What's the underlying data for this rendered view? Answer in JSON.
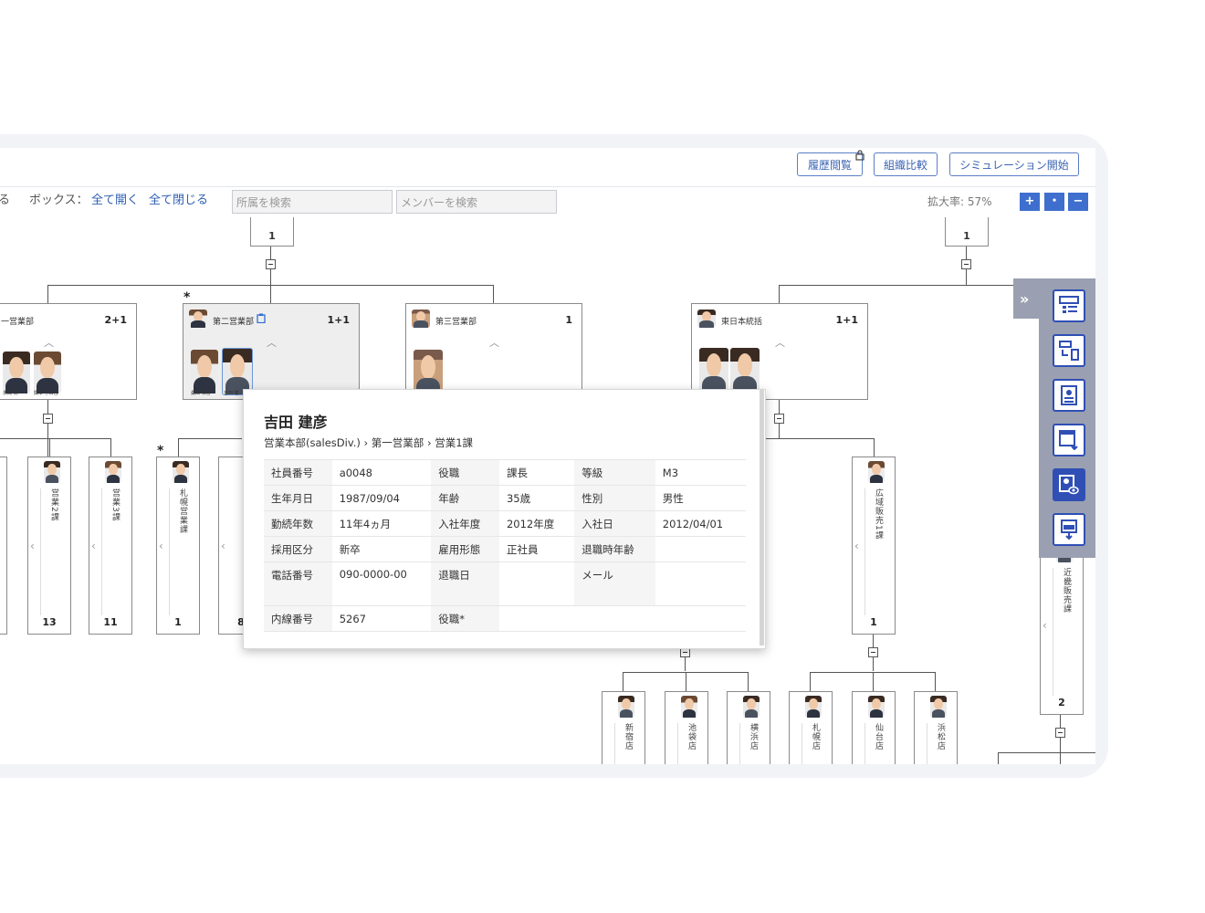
{
  "toolbar": {
    "history_button": "履歴閲覧",
    "compare_button": "組織比較",
    "simulation_button": "シミュレーション開始",
    "partial_left": "る",
    "box_label": "ボックス：",
    "open_all": "全て開く",
    "close_all": "全て閉じる",
    "dept_search_placeholder": "所属を検索",
    "member_search_placeholder": "メンバーを検索",
    "zoom_label": "拡大率: 57%",
    "zoom_in": "+",
    "zoom_reset": "・",
    "zoom_out": "−"
  },
  "top_nodes": {
    "left_count": "1",
    "right_count": "1"
  },
  "departments": [
    {
      "title": "一営業部",
      "count": "2+1"
    },
    {
      "title": "第二営業部",
      "count": "1+1",
      "star": "*"
    },
    {
      "title": "第三営業部",
      "count": "1"
    },
    {
      "title": "東日本統括",
      "count": "1+1"
    }
  ],
  "face_labels": {
    "a": "永岡 潤",
    "b": "関本 小百合",
    "c": "桑田 和香",
    "d": "吉田 建"
  },
  "sections": [
    {
      "title": "営業2課",
      "count": "13"
    },
    {
      "title": "営業3課",
      "count": "11"
    },
    {
      "title": "札幌営業課",
      "count": "1",
      "star": "*"
    },
    {
      "title": "",
      "count": "8"
    },
    {
      "title": "広域販売1課",
      "count": "1"
    },
    {
      "title": "近畿販売課",
      "count": "2"
    }
  ],
  "branches": [
    "新宿店",
    "池袋店",
    "横浜店",
    "札幌店",
    "仙台店",
    "浜松店"
  ],
  "sidebar": {
    "icons": [
      "list-layout-icon",
      "swap-layout-icon",
      "profile-card-icon",
      "table-sort-icon",
      "profile-view-icon",
      "image-download-icon"
    ]
  },
  "popup": {
    "name": "吉田 建彦",
    "path": "営業本部(salesDiv.)  ›  第一営業部  ›  営業1課",
    "rows": [
      [
        "社員番号",
        "a0048",
        "役職",
        "課長",
        "等級",
        "M3"
      ],
      [
        "生年月日",
        "1987/09/04",
        "年齢",
        "35歳",
        "性別",
        "男性"
      ],
      [
        "勤続年数",
        "11年4ヵ月",
        "入社年度",
        "2012年度",
        "入社日",
        "2012/04/01"
      ],
      [
        "採用区分",
        "新卒",
        "雇用形態",
        "正社員",
        "退職時年齢",
        ""
      ],
      [
        "電話番号",
        "090-0000-00",
        "退職日",
        "",
        "メール",
        ""
      ],
      [
        "内線番号",
        "5267",
        "役職*",
        "",
        "",
        ""
      ]
    ]
  }
}
